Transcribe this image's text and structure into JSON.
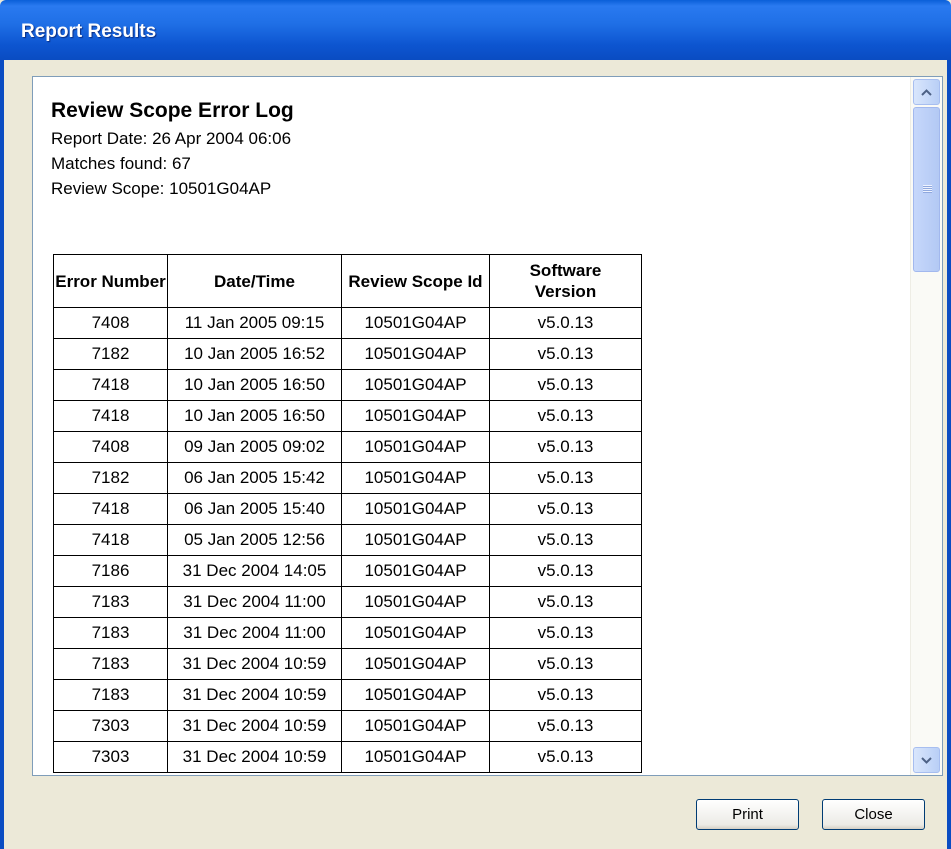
{
  "window": {
    "title": "Report Results"
  },
  "report": {
    "title": "Review Scope Error Log",
    "report_date": "Report Date: 26 Apr 2004 06:06",
    "matches_found": "Matches found: 67",
    "review_scope": "Review Scope: 10501G04AP"
  },
  "table": {
    "headers": [
      "Error Number",
      "Date/Time",
      "Review Scope Id",
      "Software Version"
    ],
    "rows": [
      [
        "7408",
        "11 Jan 2005 09:15",
        "10501G04AP",
        "v5.0.13"
      ],
      [
        "7182",
        "10 Jan 2005 16:52",
        "10501G04AP",
        "v5.0.13"
      ],
      [
        "7418",
        "10 Jan 2005 16:50",
        "10501G04AP",
        "v5.0.13"
      ],
      [
        "7418",
        "10 Jan 2005 16:50",
        "10501G04AP",
        "v5.0.13"
      ],
      [
        "7408",
        "09 Jan 2005 09:02",
        "10501G04AP",
        "v5.0.13"
      ],
      [
        "7182",
        "06 Jan 2005 15:42",
        "10501G04AP",
        "v5.0.13"
      ],
      [
        "7418",
        "06 Jan 2005 15:40",
        "10501G04AP",
        "v5.0.13"
      ],
      [
        "7418",
        "05 Jan 2005 12:56",
        "10501G04AP",
        "v5.0.13"
      ],
      [
        "7186",
        "31 Dec 2004 14:05",
        "10501G04AP",
        "v5.0.13"
      ],
      [
        "7183",
        "31 Dec 2004 11:00",
        "10501G04AP",
        "v5.0.13"
      ],
      [
        "7183",
        "31 Dec 2004 11:00",
        "10501G04AP",
        "v5.0.13"
      ],
      [
        "7183",
        "31 Dec 2004 10:59",
        "10501G04AP",
        "v5.0.13"
      ],
      [
        "7183",
        "31 Dec 2004 10:59",
        "10501G04AP",
        "v5.0.13"
      ],
      [
        "7303",
        "31 Dec 2004 10:59",
        "10501G04AP",
        "v5.0.13"
      ],
      [
        "7303",
        "31 Dec 2004 10:59",
        "10501G04AP",
        "v5.0.13"
      ]
    ]
  },
  "icons": {
    "scroll_up": "scroll-up-arrow-icon",
    "scroll_down": "scroll-down-arrow-icon"
  },
  "buttons": {
    "print": "Print",
    "close": "Close"
  }
}
